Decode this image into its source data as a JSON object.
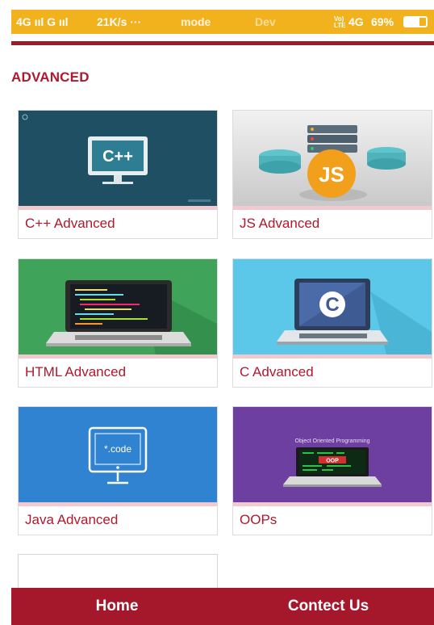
{
  "status_bar": {
    "left_signal": "4G ııl G ııl",
    "speed": "21K/s ···",
    "mode": "mode",
    "dev": "Dev",
    "volte": "Vo)\nLTE",
    "network": "4G",
    "battery_percent": "69%",
    "battery_level": 0.69,
    "background_color": "#f2b21e"
  },
  "section": {
    "title": "ADVANCED"
  },
  "courses": [
    {
      "label": "C++ Advanced",
      "icon": "cpp-monitor-icon"
    },
    {
      "label": "JS Advanced",
      "icon": "js-server-icon"
    },
    {
      "label": "HTML Advanced",
      "icon": "laptop-code-icon"
    },
    {
      "label": "C Advanced",
      "icon": "c-laptop-icon"
    },
    {
      "label": "Java Advanced",
      "icon": "code-monitor-icon"
    },
    {
      "label": "OOPs",
      "icon": "oop-laptop-icon"
    }
  ],
  "thumb_text": {
    "cpp": "C++",
    "js": "JS",
    "c": "C",
    "java": "*.code",
    "oop_title": "Object Oriented Programming",
    "oop_screen": "OOP"
  },
  "bottom_nav": {
    "home": "Home",
    "contact": "Contect Us"
  },
  "colors": {
    "accent": "#a5182c",
    "label": "#b0182d",
    "cpp_bg": "#1e4f63",
    "js_bg": "#d9d9d9",
    "html_bg": "#3fa35a",
    "c_bg": "#5bc8ea",
    "java_bg": "#2f83d0",
    "oop_bg": "#6d3fa0"
  }
}
